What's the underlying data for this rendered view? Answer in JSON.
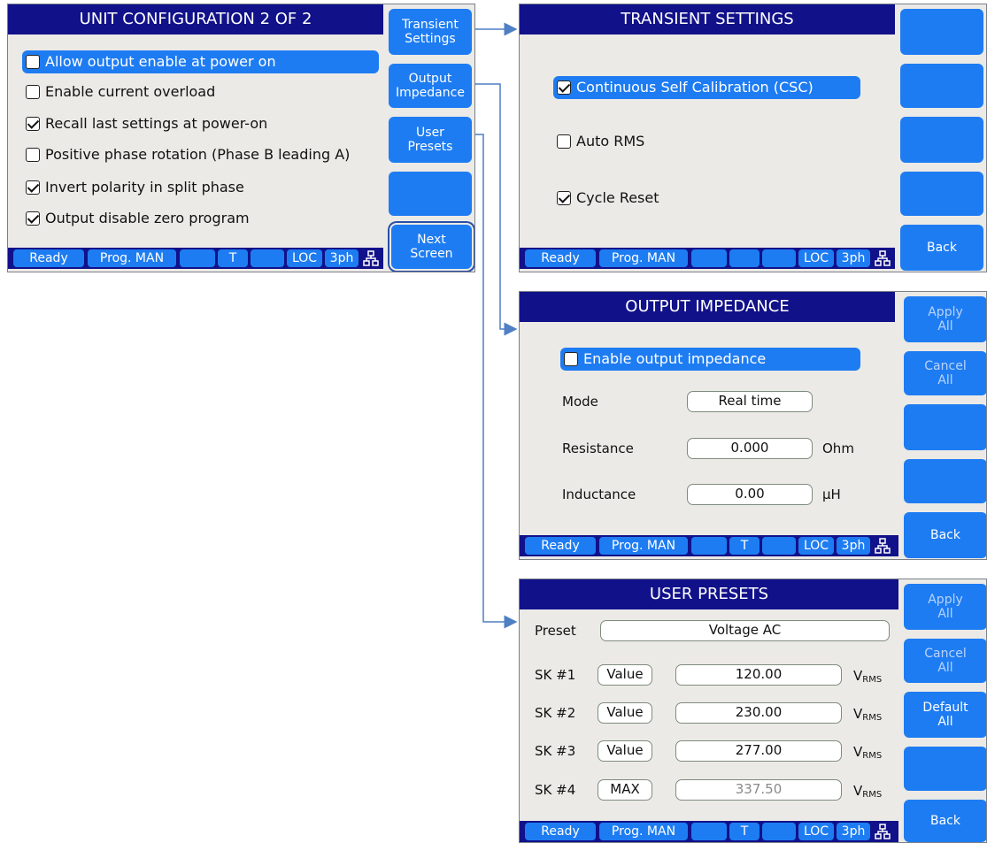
{
  "status_bar": {
    "ready": "Ready",
    "prog": "Prog. MAN",
    "t": "T",
    "loc": "LOC",
    "phase": "3ph",
    "network_icon": "network-icon"
  },
  "unit_config": {
    "title": "UNIT CONFIGURATION 2 OF 2",
    "options": [
      {
        "label": "Allow output enable at power on",
        "checked": false,
        "highlighted": true
      },
      {
        "label": "Enable current overload",
        "checked": false
      },
      {
        "label": "Recall last settings at power-on",
        "checked": true
      },
      {
        "label": "Positive phase rotation (Phase B leading A)",
        "checked": false
      },
      {
        "label": "Invert polarity in split phase",
        "checked": true
      },
      {
        "label": "Output disable zero program",
        "checked": true
      }
    ],
    "softkeys": {
      "transient_1": "Transient",
      "transient_2": "Settings",
      "output_1": "Output",
      "output_2": "Impedance",
      "user_1": "User",
      "user_2": "Presets",
      "blank": "",
      "next_1": "Next",
      "next_2": "Screen"
    }
  },
  "transient_settings": {
    "title": "TRANSIENT SETTINGS",
    "options": [
      {
        "label": "Continuous Self Calibration (CSC)",
        "checked": true,
        "highlighted": true
      },
      {
        "label": "Auto RMS",
        "checked": false
      },
      {
        "label": "Cycle Reset",
        "checked": true
      }
    ],
    "softkeys": {
      "back": "Back"
    }
  },
  "output_impedance": {
    "title": "OUTPUT IMPEDANCE",
    "enable_label": "Enable output impedance",
    "enable_checked": false,
    "mode_label": "Mode",
    "mode_value": "Real time",
    "resistance_label": "Resistance",
    "resistance_value": "0.000",
    "resistance_unit": "Ohm",
    "inductance_label": "Inductance",
    "inductance_value": "0.00",
    "inductance_unit": "µH",
    "softkeys": {
      "apply_1": "Apply",
      "apply_2": "All",
      "cancel_1": "Cancel",
      "cancel_2": "All",
      "back": "Back"
    }
  },
  "user_presets": {
    "title": "USER PRESETS",
    "preset_label": "Preset",
    "preset_value": "Voltage AC",
    "rows": [
      {
        "label": "SK #1",
        "mode": "Value",
        "value": "120.00",
        "unit": "V",
        "unit_sub": "RMS"
      },
      {
        "label": "SK #2",
        "mode": "Value",
        "value": "230.00",
        "unit": "V",
        "unit_sub": "RMS"
      },
      {
        "label": "SK #3",
        "mode": "Value",
        "value": "277.00",
        "unit": "V",
        "unit_sub": "RMS"
      },
      {
        "label": "SK #4",
        "mode": "MAX",
        "value": "337.50",
        "unit": "V",
        "unit_sub": "RMS"
      }
    ],
    "softkeys": {
      "apply_1": "Apply",
      "apply_2": "All",
      "cancel_1": "Cancel",
      "cancel_2": "All",
      "default_1": "Default",
      "default_2": "All",
      "back": "Back"
    }
  },
  "colors": {
    "title_bar": "#11118a",
    "softkey": "#1e7cf2",
    "panel_bg": "#eceae6",
    "arrow": "#4f7fc4"
  }
}
